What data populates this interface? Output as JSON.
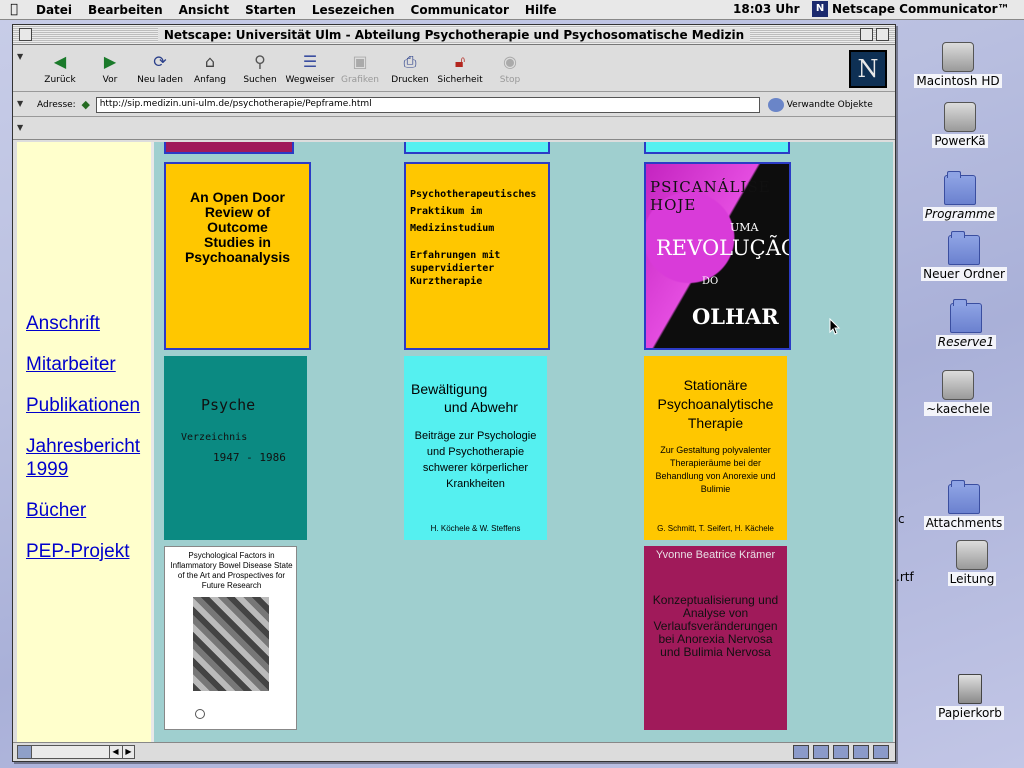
{
  "menubar": {
    "items": [
      "Datei",
      "Bearbeiten",
      "Ansicht",
      "Starten",
      "Lesezeichen",
      "Communicator",
      "Hilfe"
    ],
    "clock": "18:03 Uhr",
    "app_name": "Netscape Communicator™"
  },
  "desktop": {
    "icons": [
      {
        "label": "Macintosh HD",
        "kind": "disk"
      },
      {
        "label": "PowerKä",
        "kind": "disk"
      },
      {
        "label": "Programme",
        "kind": "folder"
      },
      {
        "label": "Neuer Ordner",
        "kind": "folder"
      },
      {
        "label": "Reserve1",
        "kind": "folder"
      },
      {
        "label": "~kaechele",
        "kind": "network"
      },
      {
        "label": "Attachments",
        "kind": "folder"
      },
      {
        "label": "Leitung",
        "kind": "network"
      },
      {
        "label": "Papierkorb",
        "kind": "trash"
      }
    ],
    "partial_labels": [
      "c",
      ".rtf"
    ]
  },
  "window": {
    "title": "Netscape: Universität Ulm - Abteilung Psychotherapie und Psychosomatische Medizin",
    "toolbar": [
      "Zurück",
      "Vor",
      "Neu laden",
      "Anfang",
      "Suchen",
      "Wegweiser",
      "Grafiken",
      "Drucken",
      "Sicherheit",
      "Stop"
    ],
    "location_label": "Adresse:",
    "url": "http://sip.medizin.uni-ulm.de/psychotherapie/Pepframe.html",
    "related": "Verwandte Objekte",
    "logo_letter": "N"
  },
  "nav": {
    "links": [
      "Anschrift",
      "Mitarbeiter",
      "Publikationen",
      "Jahresbericht 1999",
      "Bücher",
      "PEP-Projekt"
    ]
  },
  "books": {
    "open_door": "An Open Door Review of Outcome Studies in Psychoanalysis",
    "praktikum": {
      "title": "Psychotherapeutisches Praktikum im Medizinstudium",
      "subtitle": "Erfahrungen mit supervidierter Kurztherapie"
    },
    "revolucao": {
      "top": "PSICANÁLISE HOJE",
      "mid": "UMA",
      "word": "REVOLUÇÃO",
      "do": "DO",
      "olhar": "OLHAR"
    },
    "psyche": {
      "title": "Psyche",
      "sub": "Verzeichnis",
      "years": "1947 - 1986"
    },
    "bewaeltigung": {
      "title_1": "Bewältigung",
      "title_2": "und Abwehr",
      "sub": "Beiträge zur Psychologie und Psychotherapie schwerer körperlicher Krankheiten",
      "authors": "H. Köchele & W. Steffens"
    },
    "stationaere": {
      "title": "Stationäre Psychoanalytische Therapie",
      "sub": "Zur Gestaltung polyvalenter Therapieräume bei der Behandlung von Anorexie und Bulimie",
      "authors": "G. Schmitt, T. Seifert, H. Kächele"
    },
    "ibd": {
      "title": "Psychological Factors in Inflammatory Bowel Disease State of the Art and Prospectives for Future Research"
    },
    "kraemer": {
      "author": "Yvonne Beatrice Krämer",
      "title": "Konzeptualisierung und Analyse von Verlaufsveränderungen bei Anorexia Nervosa und Bulimia Nervosa"
    }
  }
}
